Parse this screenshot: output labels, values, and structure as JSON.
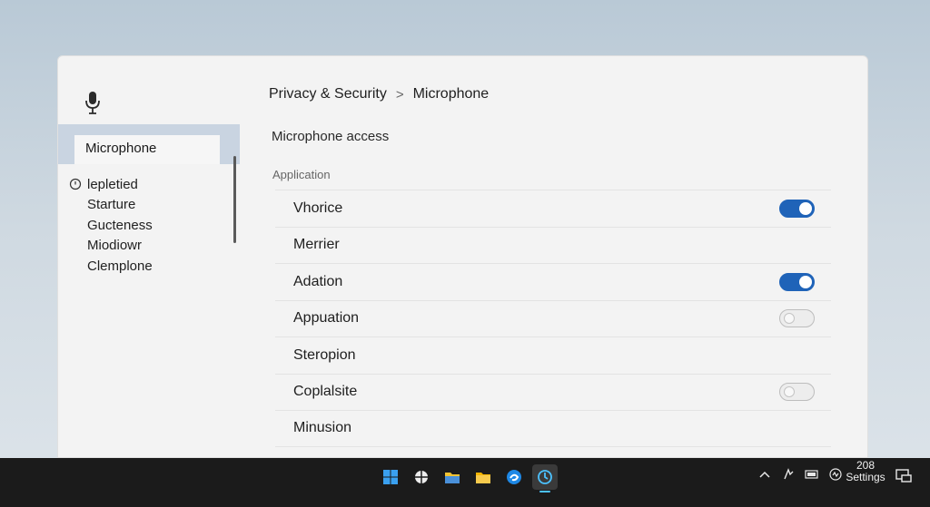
{
  "sidebar": {
    "selected_label": "Microphone",
    "items": [
      {
        "label": "lepletied",
        "icon": "clock-icon"
      },
      {
        "label": "Starture"
      },
      {
        "label": "Gucteness"
      },
      {
        "label": "Miodiowr"
      },
      {
        "label": "Clemplone"
      }
    ]
  },
  "header": {
    "breadcrumb": [
      "Privacy & Security",
      "Microphone"
    ],
    "separator": ">"
  },
  "main": {
    "section_title": "Microphone access",
    "column_header": "Application",
    "apps": [
      {
        "name": "Vhorice",
        "toggle": "on"
      },
      {
        "name": "Merrier",
        "toggle": "none"
      },
      {
        "name": "Adation",
        "toggle": "on"
      },
      {
        "name": "Appuation",
        "toggle": "off"
      },
      {
        "name": "Steropion",
        "toggle": "none"
      },
      {
        "name": "Coplalsite",
        "toggle": "off"
      },
      {
        "name": "Minusion",
        "toggle": "none"
      }
    ]
  },
  "taskbar": {
    "apps": [
      "start-icon",
      "widgets-icon",
      "file-explorer-icon",
      "folder-icon",
      "edge-icon",
      "settings-app-icon"
    ],
    "active_app": "settings-app-icon",
    "tray": [
      "chevron-up-icon",
      "network-icon",
      "battery-icon",
      "volume-icon"
    ],
    "clock_line1": "208",
    "clock_line2": "Settings"
  },
  "colors": {
    "accent": "#1f63b8",
    "sidebar_highlight": "#c9d4e1",
    "taskbar": "#1b1b1b"
  }
}
